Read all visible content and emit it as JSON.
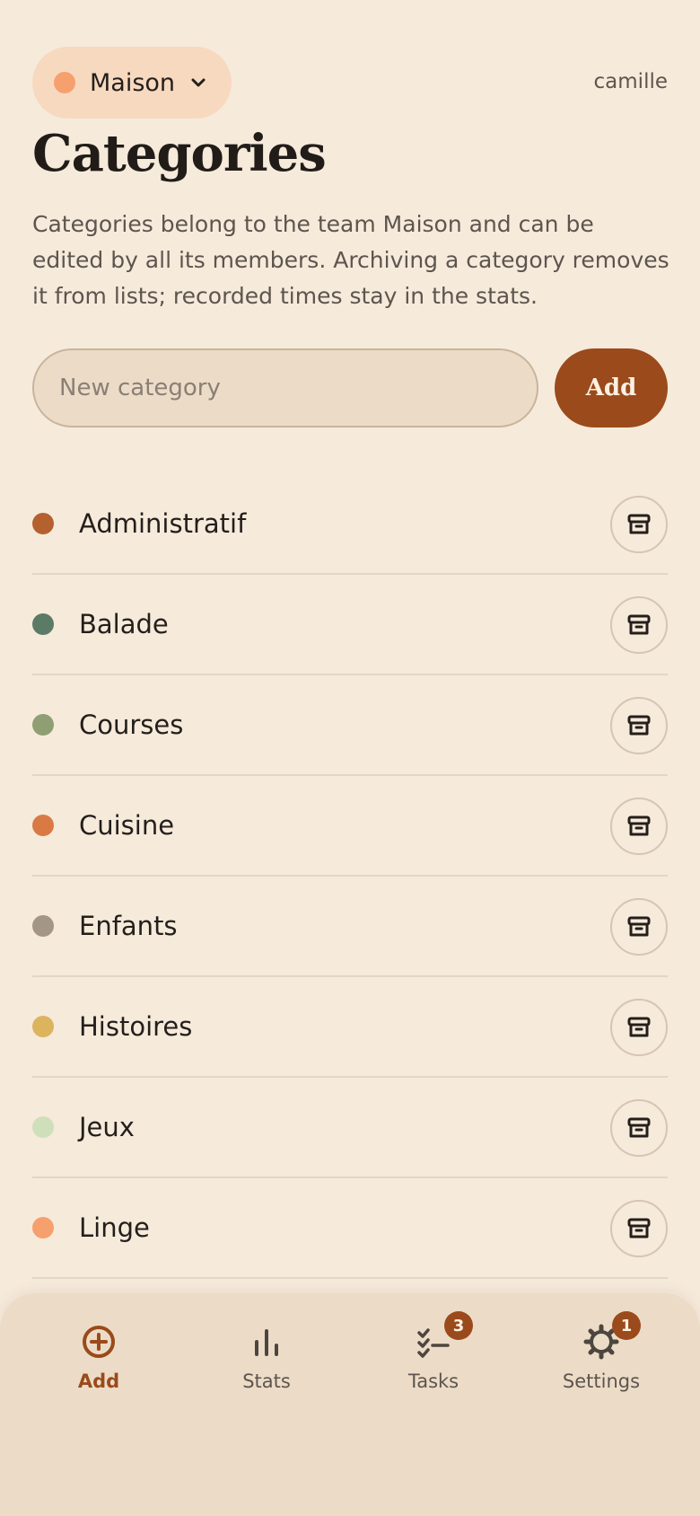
{
  "header": {
    "team_name": "Maison",
    "team_color": "#f6a06e",
    "team_icon": "chevron-down-icon",
    "username": "camille"
  },
  "page": {
    "title": "Categories",
    "description": "Categories belong to the team Maison and can be edited by all its members. Archiving a category removes it from lists; recorded times stay in the stats."
  },
  "new_category": {
    "placeholder": "New category",
    "value": "",
    "add_label": "Add"
  },
  "categories": [
    {
      "label": "Administratif",
      "color": "#b5602f",
      "action_icon": "archive-icon"
    },
    {
      "label": "Balade",
      "color": "#5c7b67",
      "action_icon": "archive-icon"
    },
    {
      "label": "Courses",
      "color": "#8f9f73",
      "action_icon": "archive-icon"
    },
    {
      "label": "Cuisine",
      "color": "#d97a45",
      "action_icon": "archive-icon"
    },
    {
      "label": "Enfants",
      "color": "#a39686",
      "action_icon": "archive-icon"
    },
    {
      "label": "Histoires",
      "color": "#dcb45e",
      "action_icon": "archive-icon"
    },
    {
      "label": "Jeux",
      "color": "#cfdfba",
      "action_icon": "archive-icon"
    },
    {
      "label": "Linge",
      "color": "#f6a06e",
      "action_icon": "archive-icon"
    }
  ],
  "tabs": [
    {
      "label": "Add",
      "icon": "plus-circle-icon",
      "active": true
    },
    {
      "label": "Stats",
      "icon": "bar-chart-icon"
    },
    {
      "label": "Tasks",
      "icon": "checklist-icon",
      "badge": "3"
    },
    {
      "label": "Settings",
      "icon": "gear-icon",
      "badge": "1"
    }
  ],
  "colors": {
    "accent": "#9b4a1b",
    "background": "#f6eadb",
    "tabbar": "#ecdcc7"
  }
}
